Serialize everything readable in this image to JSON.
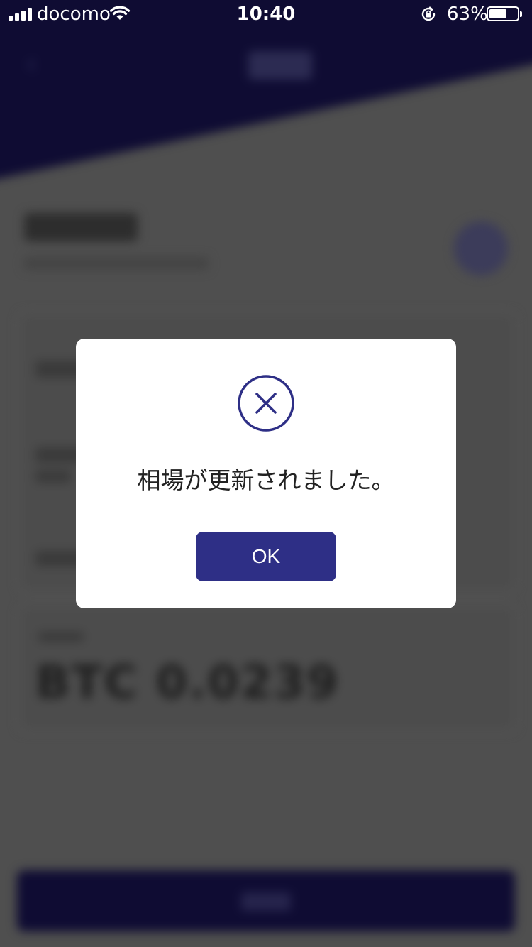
{
  "status_bar": {
    "carrier": "docomo",
    "time": "10:40",
    "battery_percent_label": "63%",
    "battery_level": 0.63
  },
  "dialog": {
    "icon": "circle-x-icon",
    "message": "相場が更新されました。",
    "ok_label": "OK"
  },
  "background": {
    "balance_text": "BTC 0.0239"
  },
  "colors": {
    "accent": "#2e2f86",
    "header": "#0f0c33",
    "overlay": "#4f4f4f"
  }
}
